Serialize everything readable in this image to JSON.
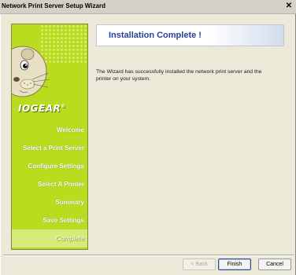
{
  "window": {
    "title": "Network Print Server Setup Wizard",
    "close_glyph": "✕"
  },
  "sidebar": {
    "logo_text": "IOGEAR",
    "logo_mark": "®",
    "steps": [
      {
        "label": "Welcome",
        "active": false
      },
      {
        "label": "Select a Print Server",
        "active": false
      },
      {
        "label": "Configure Settings",
        "active": false
      },
      {
        "label": "Select A Printer",
        "active": false
      },
      {
        "label": "Summary",
        "active": false
      },
      {
        "label": "Save Settings",
        "active": false
      },
      {
        "label": "Complete",
        "active": true
      }
    ]
  },
  "main": {
    "heading": "Installation Complete !",
    "message": "The Wizard has successfully installed the network print server and the printer on your system."
  },
  "buttons": {
    "back_label": "< Back",
    "finish_label": "Finish",
    "cancel_label": "Cancel"
  },
  "colors": {
    "sidebar_green": "#b9dd1e",
    "heading_blue": "#2a3f9a"
  }
}
